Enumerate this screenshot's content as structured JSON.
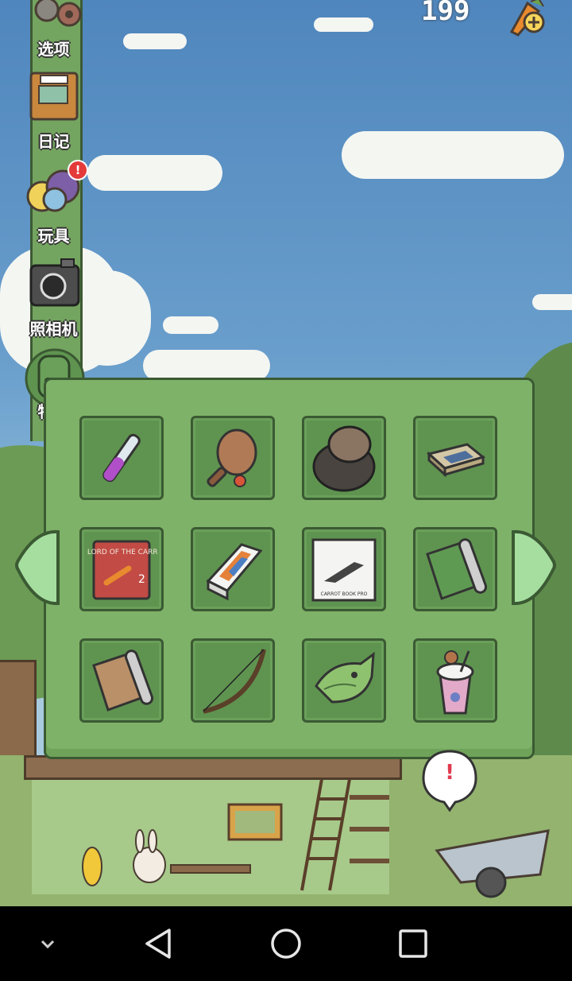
{
  "hud": {
    "currency_display": "199",
    "add_carrot_icon": "carrot-plus-icon"
  },
  "side_menu": {
    "items": [
      {
        "key": "options",
        "label": "选项",
        "icon": "gear-icon"
      },
      {
        "key": "diary",
        "label": "日记",
        "icon": "diary-book-icon"
      },
      {
        "key": "toys",
        "label": "玩具",
        "icon": "toy-balls-icon",
        "badge": "!"
      },
      {
        "key": "camera",
        "label": "照相机",
        "icon": "camera-icon"
      },
      {
        "key": "items",
        "label": "物品",
        "icon": "backpack-icon"
      }
    ]
  },
  "inventory": {
    "items": [
      {
        "name": "test-tube"
      },
      {
        "name": "paddle-ball"
      },
      {
        "name": "straw-hat-cape"
      },
      {
        "name": "matchbox"
      },
      {
        "name": "lord-of-the-carrots-book",
        "cover_text": "THE LORD OF THE CARROTS",
        "volume": "2"
      },
      {
        "name": "smartphone-box"
      },
      {
        "name": "laptop-box",
        "box_text": "CARROT BOOK PRO"
      },
      {
        "name": "green-rolled-paper"
      },
      {
        "name": "brown-rolled-paper"
      },
      {
        "name": "bow"
      },
      {
        "name": "taiyaki-fish"
      },
      {
        "name": "frappe-drink"
      }
    ],
    "prev_page_icon": "left-arrow-icon",
    "next_page_icon": "right-arrow-icon"
  },
  "scene": {
    "alert_bubble": "!"
  },
  "colors": {
    "panel": "#7eb268",
    "slot": "#5f9450",
    "border": "#3b5a33",
    "arrow": "#a6dea0",
    "badge": "#e53a3a"
  }
}
